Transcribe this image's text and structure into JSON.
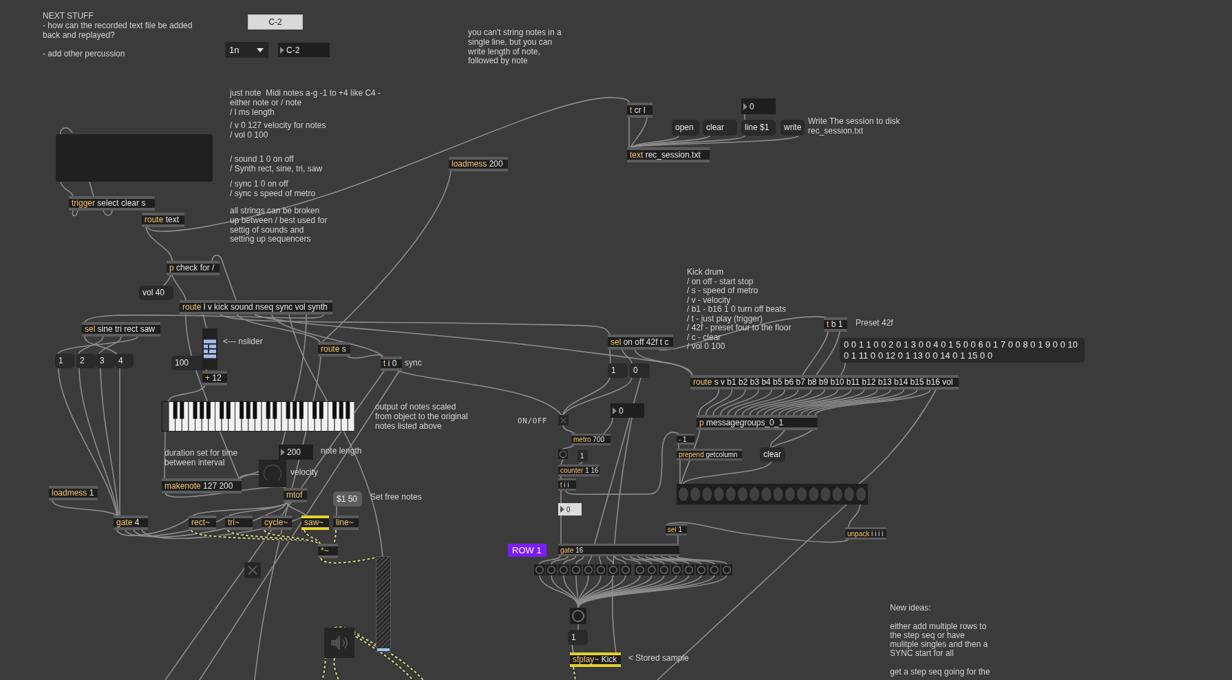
{
  "comments": [
    "NEXT STUFF\n- how can the recorded text file be added\nback and replayed?\n\n- add other percussion",
    "you can't string notes in a\nsingle line, but you can\nwrite length of note,\nfollowed by note",
    "just note  Midi notes a-g -1 to +4 like C4 -\neither note or / note\n/ l ms length",
    "/ v 0 127 velocity for notes\n/ vol 0 100",
    "/ sound 1 0 on off\n/ Synth rect, sine, tri, saw",
    "/ sync 1 0 on off\n/ sync s speed of metro",
    "all strings can be broken\nup between / best used for\nsettig of sounds and\nsetting up sequencers",
    "Write The session to disk\nrec_session.txt",
    "Kick drum\n/ on off - start stop\n/ s - speed of metro\n/ v - velocity\n/ b1 - b16 1 0 turn off beats\n/ t - just play (trigger)\n/ 42f - preset four to the floor\n/ c - clear\n/ vol 0 100",
    "Preset 42f",
    "<--- nslider",
    "sync",
    "output of notes scaled\nfrom object to the original\nnotes listed above",
    "ON/OFF",
    "duration set for time\nbetween interval",
    "note length",
    "velocity",
    "Set free notes",
    "< Stored sample",
    "New ideas:\n\neither add multiple rows to\nthe step seq or have\nmulitple singles and then a\nSYNC start for all\n\nget a step seq going for the"
  ],
  "objects": [
    {
      "class": "trigger",
      "args": "select clear s",
      "highlighted": false
    },
    {
      "class": "route",
      "args": "text",
      "highlighted": false
    },
    {
      "class": "p",
      "args": "check for /",
      "highlighted": false
    },
    {
      "class": "route",
      "args": "l v kick sound nseq sync vol synth",
      "highlighted": false
    },
    {
      "class": "sel",
      "args": "sine tri rect saw",
      "highlighted": false
    },
    {
      "class": "t",
      "args": "cr l",
      "highlighted": false
    },
    {
      "class": "text",
      "args": "rec_session.txt",
      "highlighted": false
    },
    {
      "class": "loadmess",
      "args": "200",
      "highlighted": false
    },
    {
      "class": "route",
      "args": "s",
      "highlighted": false
    },
    {
      "class": "t",
      "args": "i 0",
      "highlighted": false
    },
    {
      "class": "+",
      "args": "12",
      "highlighted": false
    },
    {
      "class": "makenote",
      "args": "127 200",
      "highlighted": false
    },
    {
      "class": "mtof",
      "highlighted": false
    },
    {
      "class": "loadmess",
      "args": "1",
      "highlighted": false
    },
    {
      "class": "gate",
      "args": "4",
      "highlighted": false
    },
    {
      "class": "rect~",
      "highlighted": false
    },
    {
      "class": "tri~",
      "highlighted": false
    },
    {
      "class": "cycle~",
      "highlighted": false
    },
    {
      "class": "saw~",
      "highlighted": true
    },
    {
      "class": "line~",
      "highlighted": false
    },
    {
      "class": "*~",
      "highlighted": false
    },
    {
      "class": "sel",
      "args": "on off 42f t c",
      "highlighted": false
    },
    {
      "class": "t",
      "args": "b 1",
      "highlighted": false
    },
    {
      "class": "route",
      "args": "s v b1 b2 b3 b4 b5 b6 b7 b8 b9 b10 b11 b12 b13 b14 b15 b16 vol",
      "highlighted": false
    },
    {
      "class": "p",
      "args": "messagegroups_0_1",
      "highlighted": false
    },
    {
      "class": "metro",
      "args": "700",
      "highlighted": false
    },
    {
      "class": "counter",
      "args": "1 16",
      "highlighted": false
    },
    {
      "class": "t",
      "args": "i i",
      "highlighted": false
    },
    {
      "class": "-",
      "args": "1",
      "highlighted": false
    },
    {
      "class": "prepend",
      "args": "getcolumn",
      "highlighted": false
    },
    {
      "class": "sel",
      "args": "1",
      "highlighted": false
    },
    {
      "class": "gate",
      "args": "16",
      "highlighted": false
    },
    {
      "class": "unpack",
      "args": "i i i i",
      "highlighted": false
    },
    {
      "class": "sfplay~",
      "args": "Kick",
      "highlighted": true
    }
  ],
  "messages": [
    {
      "text": "vol 40",
      "highlighted": false
    },
    {
      "text": "open",
      "highlighted": false
    },
    {
      "text": "clear",
      "highlighted": false
    },
    {
      "text": "line $1",
      "highlighted": false
    },
    {
      "text": "write",
      "highlighted": false
    },
    {
      "text": "1",
      "highlighted": false
    },
    {
      "text": "2",
      "highlighted": false
    },
    {
      "text": "3",
      "highlighted": false
    },
    {
      "text": "4",
      "highlighted": false
    },
    {
      "text": "100",
      "highlighted": false
    },
    {
      "text": "1",
      "highlighted": false
    },
    {
      "text": "0",
      "highlighted": false
    },
    {
      "text": "0 0 1 1 0 0 2 0 1 3 0 0 4 0 1 5 0 0 6 0 1 7 0 0 8 0 1 9 0 0 10 0 1 11 0 0 12 0 1 13 0 0 14 0 1 15 0 0",
      "highlighted": false
    },
    {
      "text": "$1 50",
      "highlighted": true
    },
    {
      "text": "1",
      "highlighted": false
    },
    {
      "text": "clear",
      "highlighted": false
    },
    {
      "text": "1",
      "highlighted": false
    }
  ],
  "number_boxes": [
    {
      "kind": "dark",
      "value": "C-2"
    },
    {
      "kind": "dark",
      "value": "0"
    },
    {
      "kind": "dark",
      "value": "200"
    },
    {
      "kind": "dark",
      "value": "0"
    },
    {
      "kind": "light",
      "value": "0"
    }
  ],
  "note_button": {
    "label": "C-2"
  },
  "menu": {
    "value": "1n"
  },
  "toggles": [
    {
      "checked": false
    },
    {
      "checked": false
    }
  ],
  "gain_slider": {
    "level": 0
  },
  "row_label": "ROW 1"
}
